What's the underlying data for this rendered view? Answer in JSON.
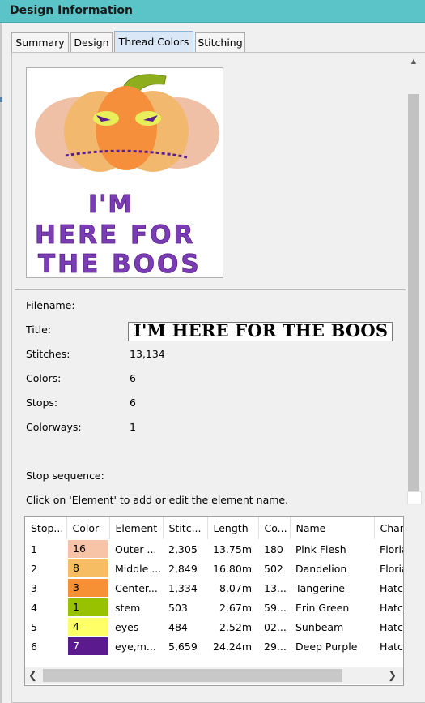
{
  "window": {
    "title": "Design Information"
  },
  "tabs": [
    {
      "label": "Summary",
      "active": false
    },
    {
      "label": "Design",
      "active": false
    },
    {
      "label": "Thread Colors",
      "active": true
    },
    {
      "label": "Stitching",
      "active": false
    }
  ],
  "preview": {
    "text_lines": [
      "I'M",
      "HERE FOR",
      "THE BOOS"
    ],
    "colors": {
      "text": "#7b3db4",
      "pumpkin_outer": "#f0c2a8",
      "pumpkin_middle": "#f6b46b",
      "pumpkin_center": "#f48b3a",
      "stem": "#8fae1e",
      "eyes": "#e5ef58",
      "accent": "#5a1f8e"
    }
  },
  "info": {
    "filename_label": "Filename:",
    "filename_value": "",
    "title_label": "Title:",
    "title_value": "I'M HERE FOR THE BOOS",
    "stitches_label": "Stitches:",
    "stitches_value": "13,134",
    "colors_label": "Colors:",
    "colors_value": "6",
    "stops_label": "Stops:",
    "stops_value": "6",
    "colorways_label": "Colorways:",
    "colorways_value": "1",
    "stop_sequence_label": "Stop sequence:",
    "instruction": "Click on 'Element' to add or edit the element name."
  },
  "table": {
    "headers": [
      "Stop...",
      "Color",
      "Element",
      "Stitc...",
      "Length",
      "Co...",
      "Name",
      "Chart"
    ],
    "rows": [
      {
        "stop": "1",
        "color": "16",
        "swatch": "#f7c4a8",
        "element": "Outer ...",
        "stitches": "2,305",
        "length": "13.75m",
        "code": "180",
        "name": "Pink Flesh",
        "chart": "Floria"
      },
      {
        "stop": "2",
        "color": "8",
        "swatch": "#f6bd62",
        "element": "Middle ...",
        "stitches": "2,849",
        "length": "16.80m",
        "code": "502",
        "name": "Dandelion",
        "chart": "Floria"
      },
      {
        "stop": "3",
        "color": "3",
        "swatch": "#f78f35",
        "element": "Center...",
        "stitches": "1,334",
        "length": "8.07m",
        "code": "13...",
        "name": "Tangerine",
        "chart": "Hatch"
      },
      {
        "stop": "4",
        "color": "1",
        "swatch": "#98c200",
        "element": "stem",
        "stitches": "503",
        "length": "2.67m",
        "code": "59...",
        "name": "Erin Green",
        "chart": "Hatch"
      },
      {
        "stop": "5",
        "color": "4",
        "swatch": "#ffff66",
        "element": "eyes",
        "stitches": "484",
        "length": "2.52m",
        "code": "02...",
        "name": "Sunbeam",
        "chart": "Hatch"
      },
      {
        "stop": "6",
        "color": "7",
        "swatch": "#5b1a8e",
        "swatch_text": "#ffffff",
        "element": "eye,m...",
        "stitches": "5,659",
        "length": "24.24m",
        "code": "29...",
        "name": "Deep Purple",
        "chart": "Hatch"
      }
    ]
  },
  "icons": {
    "scroll_up": "scroll-up-arrow-icon",
    "scroll_left": "scroll-left-arrow-icon",
    "scroll_right": "scroll-right-arrow-icon"
  }
}
